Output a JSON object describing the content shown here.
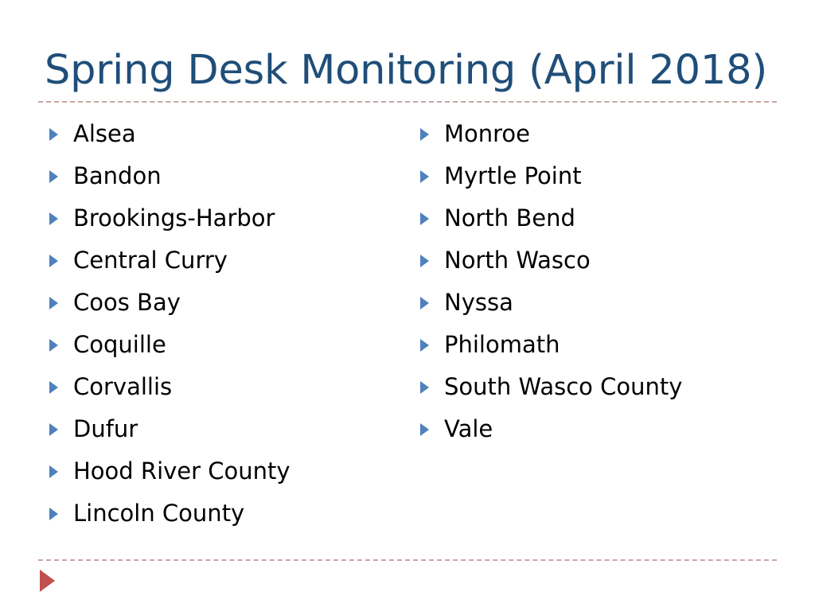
{
  "slide": {
    "title": "Spring Desk Monitoring (April 2018)",
    "background_color": "#FFFFFF",
    "title_color": "#1F4E79",
    "rule_color": "#C9A6A4",
    "bullet_color": "#4F81BD",
    "text_color": "#000000",
    "orphan_bullet_color": "#C0504D"
  },
  "content": {
    "left_column": [
      {
        "label": "Alsea"
      },
      {
        "label": "Bandon"
      },
      {
        "label": "Brookings-Harbor"
      },
      {
        "label": "Central Curry"
      },
      {
        "label": "Coos Bay"
      },
      {
        "label": "Coquille"
      },
      {
        "label": "Corvallis"
      },
      {
        "label": "Dufur"
      },
      {
        "label": "Hood River County"
      },
      {
        "label": "Lincoln County"
      }
    ],
    "right_column": [
      {
        "label": "Monroe"
      },
      {
        "label": "Myrtle Point"
      },
      {
        "label": "North Bend"
      },
      {
        "label": "North Wasco"
      },
      {
        "label": "Nyssa"
      },
      {
        "label": "Philomath"
      },
      {
        "label": "South Wasco County"
      },
      {
        "label": "Vale"
      }
    ]
  }
}
